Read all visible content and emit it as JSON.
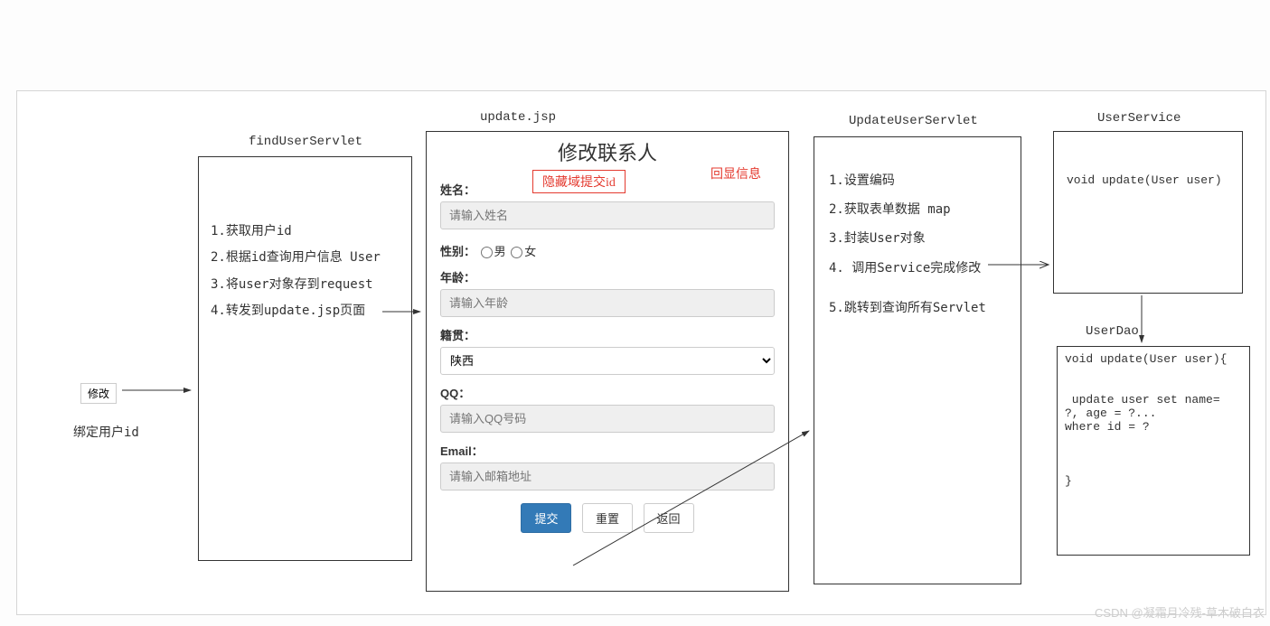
{
  "modifyButton": "修改",
  "bindUserLabel": "绑定用户id",
  "findUserServlet": {
    "title": "findUserServlet",
    "items": [
      "1.获取用户id",
      "2.根据id查询用户信息 User",
      "3.将user对象存到request",
      "4.转发到update.jsp页面"
    ]
  },
  "updateJsp": {
    "title": "update.jsp",
    "formTitle": "修改联系人",
    "echoNote": "回显信息",
    "hiddenIdNote": "隐藏域提交id",
    "labels": {
      "name": "姓名：",
      "gender": "性别：",
      "male": "男",
      "female": "女",
      "age": "年龄：",
      "hometown": "籍贯：",
      "qq": "QQ：",
      "email": "Email："
    },
    "placeholders": {
      "name": "请输入姓名",
      "age": "请输入年龄",
      "qq": "请输入QQ号码",
      "email": "请输入邮箱地址"
    },
    "hometownValue": "陕西",
    "buttons": {
      "submit": "提交",
      "reset": "重置",
      "back": "返回"
    }
  },
  "updateUserServlet": {
    "title": "UpdateUserServlet",
    "items": [
      "1.设置编码",
      "2.获取表单数据 map",
      "3.封装User对象",
      "4. 调用Service完成修改",
      "5.跳转到查询所有Servlet"
    ]
  },
  "userService": {
    "title": "UserService",
    "code": "void update(User user)"
  },
  "userDao": {
    "title": "UserDao",
    "code": "void update(User user){\n\n\n update user set name=\n?, age = ?...\nwhere id = ?\n\n\n\n}"
  },
  "watermark": "CSDN @凝霜月冷残-草木破白衣"
}
